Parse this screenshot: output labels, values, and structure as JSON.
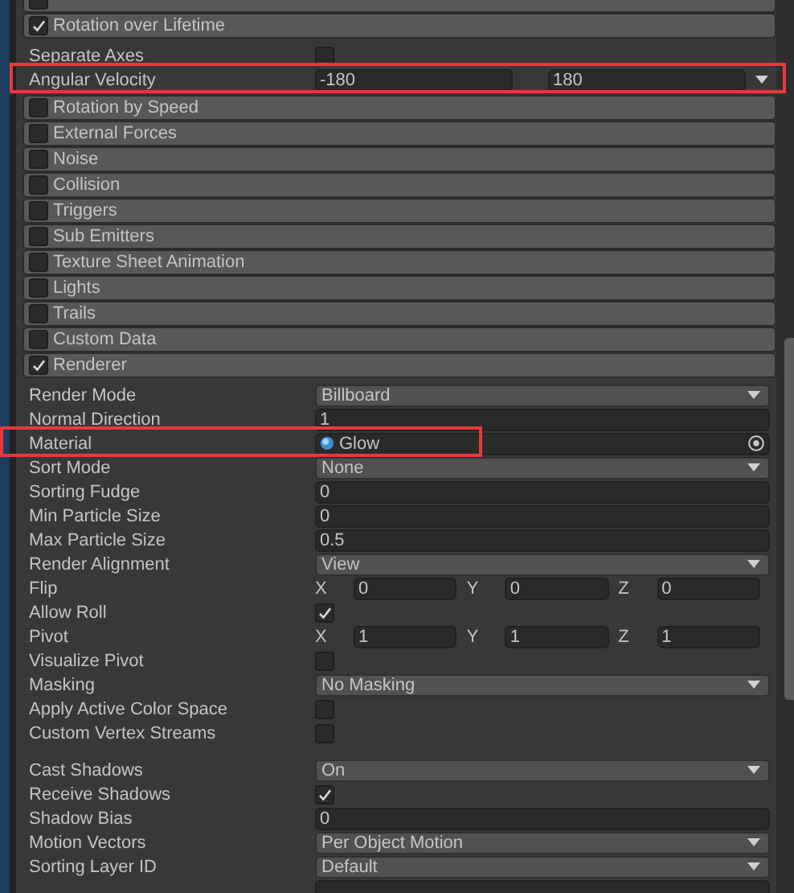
{
  "modules": [
    {
      "checked": false
    },
    {
      "label": "Rotation over Lifetime",
      "checked": true,
      "property_groups": [
        [
          {
            "kind": "checkbox",
            "label": "Separate Axes",
            "checked": false
          },
          {
            "kind": "range",
            "label": "Angular Velocity",
            "min": "-180",
            "max": "180",
            "highlighted": true
          }
        ]
      ]
    },
    {
      "label": "Rotation by Speed",
      "checked": false
    },
    {
      "label": "External Forces",
      "checked": false
    },
    {
      "label": "Noise",
      "checked": false
    },
    {
      "label": "Collision",
      "checked": false
    },
    {
      "label": "Triggers",
      "checked": false
    },
    {
      "label": "Sub Emitters",
      "checked": false
    },
    {
      "label": "Texture Sheet Animation",
      "checked": false
    },
    {
      "label": "Lights",
      "checked": false
    },
    {
      "label": "Trails",
      "checked": false
    },
    {
      "label": "Custom Data",
      "checked": false
    },
    {
      "label": "Renderer",
      "checked": true,
      "property_groups": [
        [
          {
            "kind": "dropdown",
            "label": "Render Mode",
            "value": "Billboard"
          },
          {
            "kind": "field",
            "label": "Normal Direction",
            "value": "1"
          },
          {
            "kind": "object",
            "label": "Material",
            "value": "Glow",
            "highlighted": true
          },
          {
            "kind": "dropdown",
            "label": "Sort Mode",
            "value": "None"
          },
          {
            "kind": "field",
            "label": "Sorting Fudge",
            "value": "0"
          },
          {
            "kind": "field",
            "label": "Min Particle Size",
            "value": "0"
          },
          {
            "kind": "field",
            "label": "Max Particle Size",
            "value": "0.5"
          },
          {
            "kind": "dropdown",
            "label": "Render Alignment",
            "value": "View"
          },
          {
            "kind": "vector3",
            "label": "Flip",
            "components": [
              {
                "axis": "X",
                "value": "0"
              },
              {
                "axis": "Y",
                "value": "0"
              },
              {
                "axis": "Z",
                "value": "0"
              }
            ]
          },
          {
            "kind": "checkbox",
            "label": "Allow Roll",
            "checked": true
          },
          {
            "kind": "vector3",
            "label": "Pivot",
            "components": [
              {
                "axis": "X",
                "value": "1"
              },
              {
                "axis": "Y",
                "value": "1"
              },
              {
                "axis": "Z",
                "value": "1"
              }
            ]
          },
          {
            "kind": "checkbox",
            "label": "Visualize Pivot",
            "checked": false
          },
          {
            "kind": "dropdown",
            "label": "Masking",
            "value": "No Masking"
          },
          {
            "kind": "checkbox",
            "label": "Apply Active Color Space",
            "checked": false
          },
          {
            "kind": "checkbox",
            "label": "Custom Vertex Streams",
            "checked": false
          }
        ],
        [
          {
            "kind": "dropdown",
            "label": "Cast Shadows",
            "value": "On"
          },
          {
            "kind": "checkbox",
            "label": "Receive Shadows",
            "checked": true
          },
          {
            "kind": "field",
            "label": "Shadow Bias",
            "value": "0"
          },
          {
            "kind": "dropdown",
            "label": "Motion Vectors",
            "value": "Per Object Motion"
          },
          {
            "kind": "dropdown",
            "label": "Sorting Layer ID",
            "value": "Default"
          },
          {
            "kind": "field"
          }
        ]
      ]
    }
  ]
}
